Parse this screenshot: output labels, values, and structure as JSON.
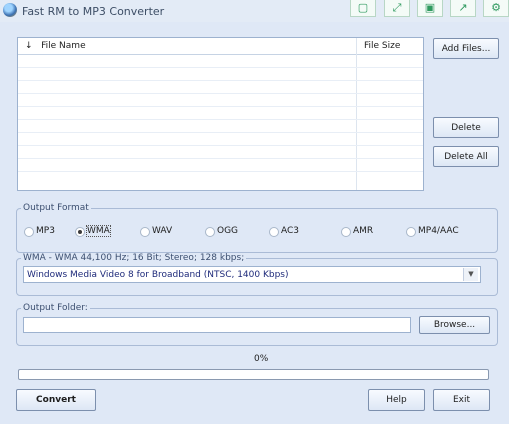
{
  "window": {
    "title": "Fast RM to MP3 Converter",
    "title_buttons": [
      {
        "icon": "save-icon",
        "glyph": "▢"
      },
      {
        "icon": "expand-icon",
        "glyph": "⤢"
      },
      {
        "icon": "floppy-icon",
        "glyph": "▣"
      },
      {
        "icon": "export-icon",
        "glyph": "↗"
      },
      {
        "icon": "gear-icon",
        "glyph": "⚙"
      }
    ]
  },
  "file_list": {
    "sort_glyph": "↓",
    "columns": [
      "File Name",
      "File Size"
    ],
    "rows": []
  },
  "buttons": {
    "add_files": "Add Files...",
    "delete": "Delete",
    "delete_all": "Delete All",
    "browse": "Browse...",
    "convert": "Convert",
    "help": "Help",
    "exit": "Exit"
  },
  "output_format": {
    "label": "Output Format",
    "options": [
      "MP3",
      "WMA",
      "WAV",
      "OGG",
      "AC3",
      "AMR",
      "MP4/AAC"
    ],
    "selected": "WMA"
  },
  "quality": {
    "label": "WMA - WMA 44,100 Hz; 16 Bit; Stereo; 128 kbps;",
    "selected_value": "Windows Media Video 8 for Broadband (NTSC, 1400 Kbps)",
    "arrow_glyph": "▼"
  },
  "output_folder": {
    "label": "Output Folder:",
    "value": ""
  },
  "progress": {
    "percent_text": "0%",
    "value": 0
  }
}
